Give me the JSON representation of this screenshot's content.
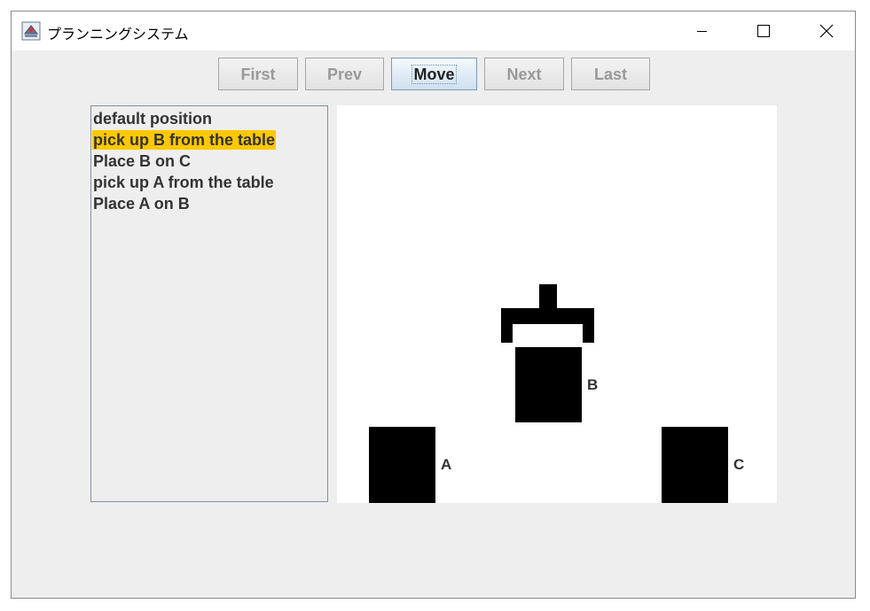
{
  "window": {
    "title": "プランニングシステム"
  },
  "toolbar": {
    "first_label": "First",
    "prev_label": "Prev",
    "move_label": "Move",
    "next_label": "Next",
    "last_label": "Last"
  },
  "steps": {
    "items": [
      {
        "label": "default position",
        "selected": false
      },
      {
        "label": "pick up B from the table",
        "selected": true
      },
      {
        "label": "Place B on C",
        "selected": false
      },
      {
        "label": "pick up A from the table",
        "selected": false
      },
      {
        "label": "Place A on B",
        "selected": false
      }
    ],
    "selection_color": "#ffc800"
  },
  "scene": {
    "blocks": [
      {
        "name": "A",
        "label": "A",
        "state": "on table"
      },
      {
        "name": "B",
        "label": "B",
        "state": "held by gripper"
      },
      {
        "name": "C",
        "label": "C",
        "state": "on table"
      }
    ],
    "block_color": "#000000",
    "gripper": {
      "holding": "B"
    }
  },
  "icons": {
    "app": "java-cup-icon",
    "minimize": "minimize-icon",
    "maximize": "maximize-icon",
    "close": "close-icon"
  }
}
